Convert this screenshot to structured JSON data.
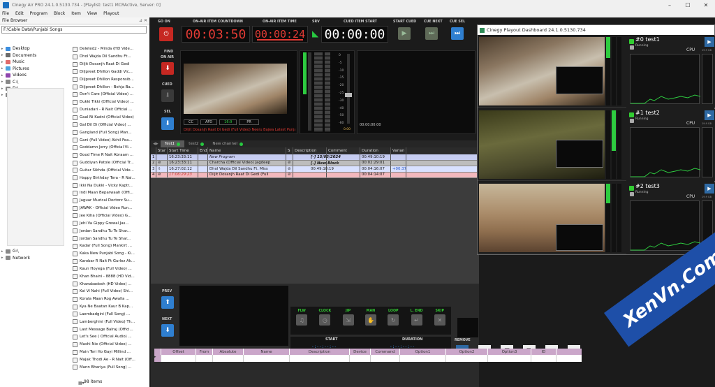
{
  "window": {
    "title": "Cinegy Air PRO 24.1.0.5130.734 - [Playlist: test1 MCRActive, Server: 0]",
    "min": "–",
    "max": "☐",
    "close": "✕"
  },
  "menu": [
    "File",
    "Edit",
    "Program",
    "Block",
    "Item",
    "View",
    "Playout"
  ],
  "file_browser": {
    "title": "File Browser",
    "pin_glyph": "⊿ ✕",
    "path": "F:\\Cable Data\\Punjabi Songs",
    "tree": [
      {
        "label": "Desktop",
        "color": "#3d8fe0"
      },
      {
        "label": "Documents",
        "color": "#6b6b6b"
      },
      {
        "label": "Music",
        "color": "#e06b6b"
      },
      {
        "label": "Pictures",
        "color": "#4aa3df"
      },
      {
        "label": "Videos",
        "color": "#8e44ad"
      },
      {
        "label": "C:\\",
        "color": "#888"
      },
      {
        "label": "D:\\",
        "color": "#888"
      },
      {
        "label": "F:\\",
        "color": "#888"
      }
    ],
    "tree_tail": [
      {
        "label": "G:\\",
        "color": "#888"
      },
      {
        "label": "Network",
        "color": "#888"
      }
    ],
    "files": [
      "Deleted2 - Minda (HD Vide...",
      "Dhol Wajda  Dil Sandhu Ft...",
      "Diljit Dosanjh  Raat Di Gedi",
      "Diljpreet Dhillon  Gaddi Vic...",
      "Diljpreet Dhillon  Responsib...",
      "Diljpreet Dhillon - Behja Ba...",
      "Don't Care (Official Video) ...",
      "Dukki Tikki (Official Video) ...",
      "Duniadari - R Nait  Official ...",
      "Gaal Ni Kadni (Official Video)",
      "Gal Dil Di (Official Video) ...",
      "Gangland (Full Song) Man...",
      "Gani (Full Video)  Akhil Fea...",
      "Goddamn Jerry (Official Vi...",
      "Good Time R Nait  Abraam ...",
      "Guddiyan Patole (Official Tr...",
      "Guitar Sikhda (Official Vide...",
      "Happy Birthday Tera - R Nai...",
      "Ikki Na Dukki - Vicky  Kaptr...",
      "Indi Maan  Beparwaah (Offi...",
      "Jaguar  Muzical Doctorz Su...",
      "JAWAK - Official Video  Run...",
      "Jee Kiha (Official Video)  G...",
      "Jehi Va  Gippy Grewal  Jas...",
      "Jordan Sandhu  Tu Te Shar...",
      "Jordan Sandhu  Tu Te Shar...",
      "Kadar (Full Song)  Mankirt ...",
      "Kaka New Punjabi Song - Ki...",
      "Karobar  R Nait Ft Gurlez Ak...",
      "Kaun Hoyega (Full Video) ...",
      "Khan Bhaini - 8888 (HD Vid...",
      "Khanabadosh (HD Video) ...",
      "Koi Vi Nahi (Full Video)  Shi...",
      "Korala Maan  Rog Awalla ...",
      "Kya Ne Baatan  Kaur B  Kap...",
      "Laembadgini (Full Song) ...",
      "Lamberghini (Full Video)  Th...",
      "Last Message  Balraj (Offici...",
      "Let's See ( Official Audio) ...",
      "Mashi Nie (Official Video) ...",
      "Main Teri Ho Gayi  Millind ...",
      "Majak Thodi Ae - R Nait (Off...",
      "Mann Bhariya (Full Song) ..."
    ],
    "count": "98 items",
    "footer": "▦▾"
  },
  "master": {
    "go_on": "GO ON",
    "go_on_glyph": "⏻",
    "countdown_label": "ON-AIR ITEM COUNTDOWN",
    "countdown": "00:03:50",
    "item_time_label": "ON-AIR ITEM TIME",
    "item_time": "00:00:24",
    "srv_label": "SRV",
    "srv_glyph": "◣",
    "cued_start_label": "CUED ITEM START",
    "cued_start": "00:00:00",
    "start_cued": "START CUED",
    "cue_next": "CUE NEXT",
    "cue_sel": "CUE SEL",
    "find": "FIND",
    "on_air": "ON AIR",
    "cued": "CUED",
    "sel": "SEL",
    "cc": "CC",
    "afd": "AFD",
    "afd_val": "16:9",
    "pr": "PR",
    "onair_caption": "Diljit Dosanjh  Raat Di Gedi (Full Video) Neeru Bajwa  Latest Punjabi",
    "preview_tc": "00:00:00:00",
    "meter_scale": [
      "0",
      "-5",
      "-10",
      "-15",
      "-20",
      "-25",
      "-30",
      "-40",
      "-50",
      "-60"
    ],
    "meter_reading": "0.00"
  },
  "playlist": {
    "tabs": [
      {
        "label": "Test1",
        "selected": true
      },
      {
        "label": "test2",
        "selected": false
      },
      {
        "label": "New channel",
        "selected": false
      }
    ],
    "columns": [
      "",
      "Star",
      "Start Time",
      "End",
      "Name",
      "S",
      "Description",
      "Comment",
      "Duration",
      "Varian"
    ],
    "rows": [
      {
        "n": "1",
        "star": "",
        "start": "16:23:33:11",
        "end": "",
        "name": "New Program",
        "s": "",
        "desc": "",
        "comment": "",
        "dur": "00:49:10:19",
        "var": "",
        "bg": "#c7cdf2",
        "first": "[-] 15/03/2024",
        "ital": true
      },
      {
        "n": "2",
        "star": "⊘",
        "start": "16:23:33:11",
        "end": "",
        "name": "Charcha (Official Video)  Jagdeep",
        "s": "⊘",
        "desc": "",
        "comment": "",
        "dur": "00:02:29:01",
        "var": "",
        "bg": "#bdbdbd",
        "first": "[-] New Block",
        "ital": false
      },
      {
        "n": "3",
        "star": "⇩",
        "start": "16:27:02:12",
        "end": "",
        "name": "Dhol Wajda  Dil Sandhu Ft. Miss",
        "s": "⊘",
        "desc": "",
        "comment": "",
        "dur": "00:04:16:07",
        "var": "+00:37",
        "bg": "#d9e1ff",
        "first": "00:49:10:19",
        "ital": false
      },
      {
        "n": "4",
        "star": "⊘",
        "start": "17:06:29:23",
        "end": "",
        "name": "Diljit Dosanjh  Raat Di Gedi (Full",
        "s": "⊘",
        "desc": "",
        "comment": "",
        "dur": "00:04:14:07",
        "var": "",
        "bg": "#f3b8bd",
        "first": "",
        "ital": false
      }
    ]
  },
  "controls": {
    "prev": "PREV",
    "next": "NEXT",
    "remove": "REMOVE",
    "start": "START",
    "duration": "DURATION",
    "start_val": "-:--:--:--",
    "duration_val": "-:--:--:--",
    "buttons": [
      {
        "label": "FLW",
        "glyph": "♫"
      },
      {
        "label": "CLOCK",
        "glyph": "◷"
      },
      {
        "label": "JIP",
        "glyph": "⇲"
      },
      {
        "label": "MAN",
        "glyph": "✋"
      },
      {
        "label": "LOOP",
        "glyph": "↻"
      },
      {
        "label": "L. END",
        "glyph": "↵"
      },
      {
        "label": "SKIP",
        "glyph": "✕"
      }
    ],
    "tools": [
      "▬",
      "➔",
      "☐",
      "⎘",
      "▤",
      "▦"
    ]
  },
  "events": {
    "columns": [
      "",
      "Offset",
      "From",
      "Absolute",
      "Name",
      "Description",
      "Device",
      "Command",
      "Option1",
      "Option2",
      "Option3",
      "ID"
    ],
    "row_marker": "▸"
  },
  "dashboard": {
    "title": "Cinegy Playout Dashboard 24.1.0.5130.734",
    "engines": [
      {
        "name": "#0 test1",
        "status": "Running",
        "cpu": "CPU",
        "m1": "19.9 GB",
        "m2": "15.9 GB"
      },
      {
        "name": "#1 test2",
        "status": "Running",
        "cpu": "CPU",
        "m1": "19.9 GB",
        "m2": "15.9 GB"
      },
      {
        "name": "#2 test3",
        "status": "Running",
        "cpu": "CPU",
        "m1": "19.9 GB",
        "m2": "15.9 GB"
      }
    ]
  },
  "watermark": "XenVn.Com",
  "colors": {
    "accent_red": "#e23b34",
    "blue": "#2f7fd0",
    "green": "#28c840"
  }
}
